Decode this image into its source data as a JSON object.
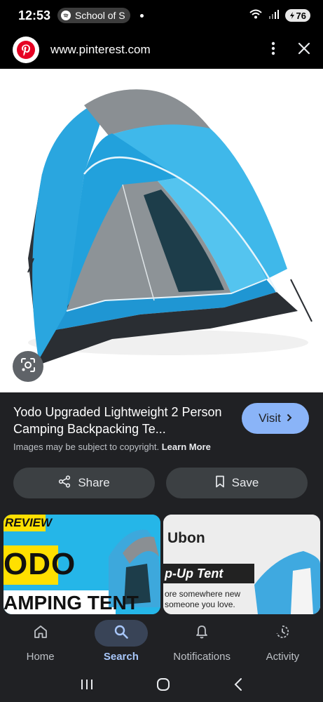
{
  "status_bar": {
    "time": "12:53",
    "spotify_label": "School of S",
    "battery": "76"
  },
  "url_bar": {
    "url": "www.pinterest.com"
  },
  "pin": {
    "title": "Yodo Upgraded Lightweight 2 Person Camping Backpacking Te...",
    "copyright_text": "Images may be subject to copyright.",
    "learn_more": "Learn More",
    "visit_label": "Visit",
    "share_label": "Share",
    "save_label": "Save"
  },
  "related": [
    {
      "lines": [
        "REVIEW",
        "ODO",
        "AMPING TENT"
      ]
    },
    {
      "lines": [
        "Ubon",
        "p-Up Tent",
        "ore somewhere new",
        "someone you love."
      ]
    }
  ],
  "bottom_nav": {
    "items": [
      {
        "label": "Home",
        "icon": "home-icon",
        "active": false
      },
      {
        "label": "Search",
        "icon": "search-icon",
        "active": true
      },
      {
        "label": "Notifications",
        "icon": "bell-icon",
        "active": false
      },
      {
        "label": "Activity",
        "icon": "activity-icon",
        "active": false
      }
    ]
  },
  "colors": {
    "accent": "#8ab4f8",
    "tent_blue": "#29a8e0",
    "background": "#202124"
  }
}
